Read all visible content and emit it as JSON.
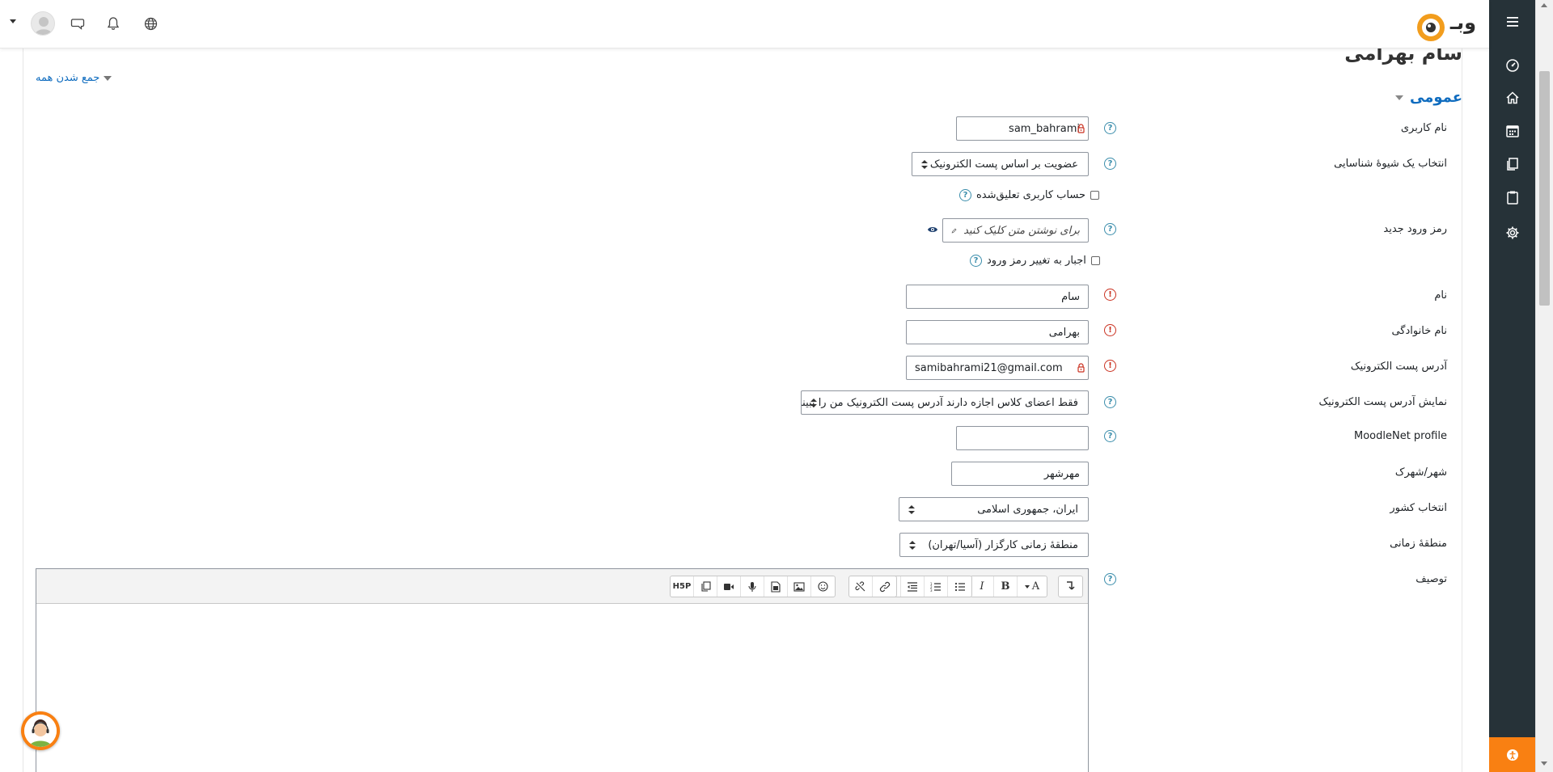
{
  "header": {
    "logo_text": "وبـ",
    "icons": [
      "caret-down-icon",
      "user-avatar",
      "chat-icon",
      "bell-icon",
      "globe-icon"
    ]
  },
  "sidebar": {
    "items": [
      "menu-icon",
      "dashboard-icon",
      "home-icon",
      "calendar-icon",
      "files-icon",
      "clipboard-icon",
      "gear-icon"
    ],
    "bottom_icon": "accessibility-icon",
    "bg_color": "#263238",
    "accent_color": "#f98012"
  },
  "page": {
    "title": "سام بهرامی",
    "collapse_all": "جمع شدن همه",
    "section": "عمومی"
  },
  "form": {
    "username": {
      "label": "نام کاربری",
      "value": "sam_bahrami"
    },
    "auth": {
      "label": "انتخاب یک شیوهٔ شناسایی",
      "value": "عضویت بر اساس پست الکترونیک"
    },
    "suspended": {
      "label": "حساب کاربری تعلیق‌شده"
    },
    "new_password": {
      "label": "رمز ورود جدید",
      "placeholder": "برای نوشتن متن کلیک کنید"
    },
    "force_change": {
      "label": "اجبار به تغییر رمز ورود"
    },
    "firstname": {
      "label": "نام",
      "value": "سام"
    },
    "lastname": {
      "label": "نام خانوادگی",
      "value": "بهرامی"
    },
    "email": {
      "label": "آدرس پست الکترونیک",
      "value": "samibahrami21@gmail.com"
    },
    "email_display": {
      "label": "نمایش آدرس پست الکترونیک",
      "value": "فقط اعضای کلاس اجازه دارند آدرس پست الکترونیک من را ببینند"
    },
    "moodlenet": {
      "label": "MoodleNet profile",
      "value": ""
    },
    "city": {
      "label": "شهر/شهرک",
      "value": "مهرشهر"
    },
    "country": {
      "label": "انتخاب کشور",
      "value": "ایران، جمهوری اسلامی"
    },
    "timezone": {
      "label": "منطقهٔ زمانی",
      "value": "منطقهٔ زمانی کارگزار (آسیا/تهران)"
    },
    "description": {
      "label": "توصیف"
    }
  },
  "editor_toolbar": {
    "groups": [
      [
        "undo-icon"
      ],
      [
        "font-style-icon",
        "bold-icon",
        "italic-icon"
      ],
      [
        "unordered-list-icon",
        "ordered-list-icon",
        "outdent-icon",
        "indent-icon"
      ],
      [
        "link-icon",
        "unlink-icon"
      ],
      [
        "emoji-icon",
        "image-icon",
        "media-icon",
        "record-audio-icon",
        "record-video-icon",
        "manage-files-icon",
        "h5p-icon"
      ]
    ],
    "h5p_label": "H5P",
    "bold_label": "B",
    "italic_label": "I",
    "font_label": "A"
  }
}
